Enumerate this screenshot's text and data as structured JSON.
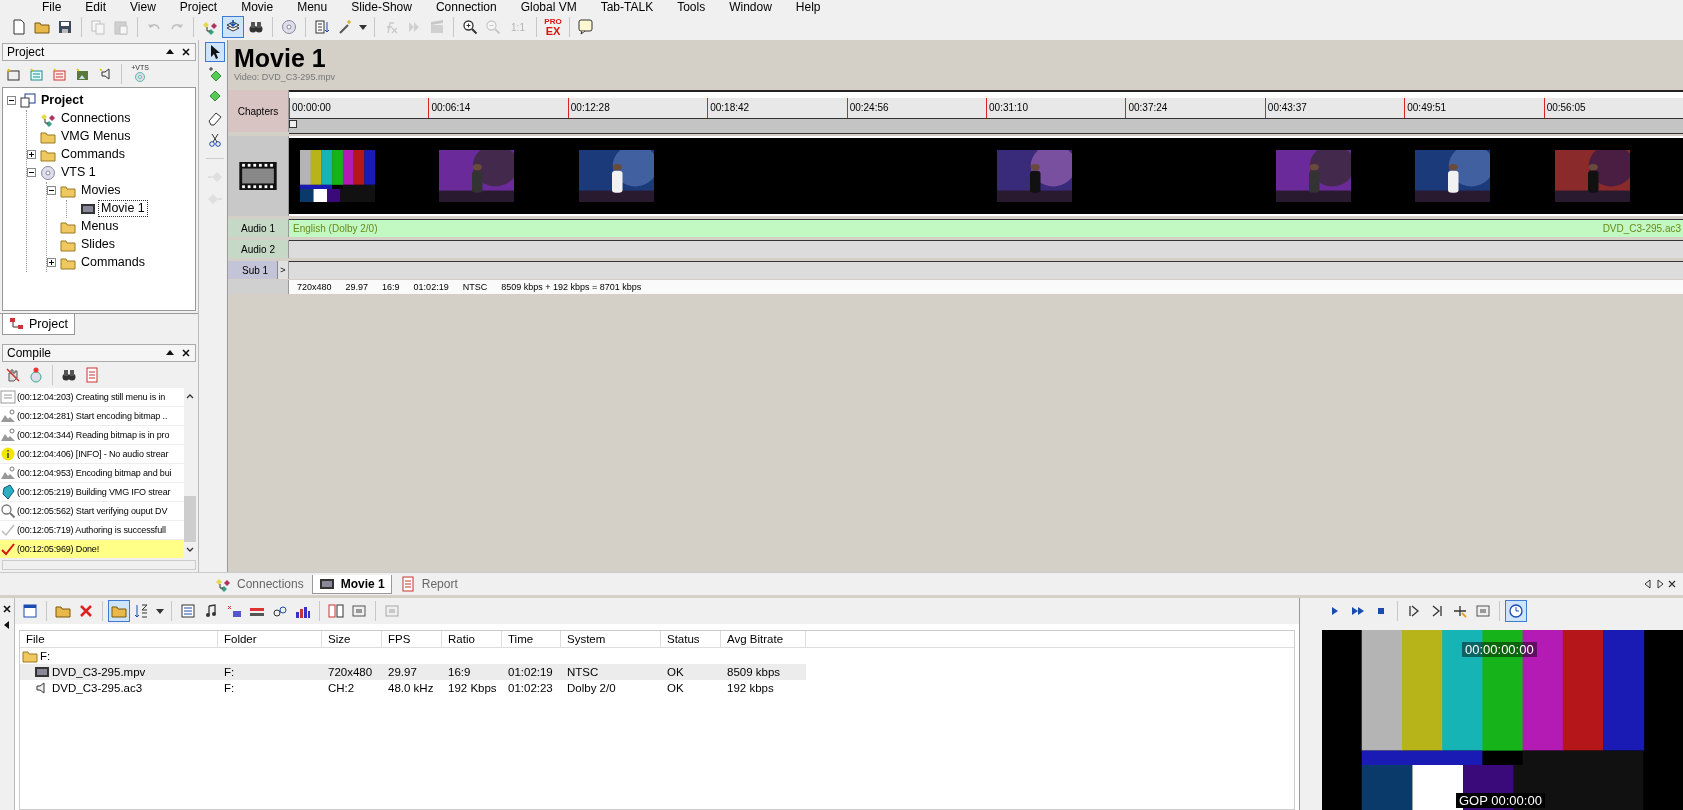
{
  "menu": [
    "File",
    "Edit",
    "View",
    "Project",
    "Movie",
    "Menu",
    "Slide-Show",
    "Connection",
    "Global VM",
    "Tab-TALK",
    "Tools",
    "Window",
    "Help"
  ],
  "toolbar": [
    [
      {
        "kind": "new",
        "pressed": false,
        "disabled": false
      },
      {
        "kind": "open",
        "pressed": false,
        "disabled": false
      },
      {
        "kind": "save",
        "pressed": false,
        "disabled": false
      }
    ],
    [
      {
        "kind": "copy",
        "pressed": false,
        "disabled": true
      },
      {
        "kind": "paste",
        "pressed": false,
        "disabled": true
      }
    ],
    [
      {
        "kind": "undo",
        "pressed": false,
        "disabled": true
      },
      {
        "kind": "redo",
        "pressed": false,
        "disabled": true
      }
    ],
    [
      {
        "kind": "connect",
        "pressed": false,
        "disabled": false
      },
      {
        "kind": "stack",
        "pressed": true,
        "disabled": false
      },
      {
        "kind": "binoculars",
        "pressed": false,
        "disabled": false
      }
    ],
    [
      {
        "kind": "disc",
        "pressed": false,
        "disabled": false
      }
    ],
    [
      {
        "kind": "list",
        "pressed": false,
        "disabled": false
      },
      {
        "kind": "wand",
        "pressed": false,
        "disabled": false
      },
      {
        "kind": "caret",
        "pressed": false,
        "disabled": false
      }
    ],
    [
      {
        "kind": "fx",
        "pressed": false,
        "disabled": true
      },
      {
        "kind": "dfx",
        "pressed": false,
        "disabled": true
      },
      {
        "kind": "clip",
        "pressed": false,
        "disabled": true
      }
    ],
    [
      {
        "kind": "zoomin",
        "pressed": false,
        "disabled": false
      },
      {
        "kind": "zoomout",
        "pressed": false,
        "disabled": true
      },
      {
        "kind": "text",
        "text": "1:1",
        "pressed": false,
        "disabled": true
      }
    ],
    [
      {
        "kind": "proex",
        "text": "PRO",
        "text2": "EX",
        "pressed": false,
        "disabled": false
      }
    ],
    [
      {
        "kind": "help",
        "pressed": false,
        "disabled": false
      }
    ]
  ],
  "project_panel": {
    "title": "Project",
    "toolbar": [
      [
        {
          "kind": "newmovie",
          "pressed": false,
          "disabled": false
        },
        {
          "kind": "newmenu",
          "pressed": false,
          "disabled": false
        },
        {
          "kind": "newmenu2",
          "pressed": false,
          "disabled": false
        },
        {
          "kind": "newslide",
          "pressed": false,
          "disabled": false
        },
        {
          "kind": "newaudio",
          "pressed": false,
          "disabled": false
        }
      ],
      [
        {
          "kind": "newvts",
          "text": "+VTS",
          "pressed": false,
          "disabled": false
        }
      ]
    ],
    "tree": [
      {
        "label": "Project",
        "kind": "project",
        "expanded": true,
        "selected": false,
        "children": [
          {
            "label": "Connections",
            "kind": "connect",
            "selected": false
          },
          {
            "label": "VMG Menus",
            "kind": "folder",
            "selected": false
          },
          {
            "label": "Commands",
            "kind": "folder",
            "expanded": false,
            "selected": false
          },
          {
            "label": "VTS 1",
            "kind": "disc",
            "expanded": true,
            "selected": false,
            "children": [
              {
                "label": "Movies",
                "kind": "folder",
                "expanded": true,
                "selected": false,
                "children": [
                  {
                    "label": "Movie 1",
                    "kind": "film",
                    "selected": true
                  }
                ]
              },
              {
                "label": "Menus",
                "kind": "folder",
                "selected": false
              },
              {
                "label": "Slides",
                "kind": "folder",
                "selected": false
              },
              {
                "label": "Commands",
                "kind": "folder",
                "expanded": false,
                "selected": false
              }
            ]
          }
        ]
      }
    ],
    "tab": "Project"
  },
  "compile_panel": {
    "title": "Compile",
    "toolbar": [
      [
        {
          "kind": "stop",
          "pressed": false,
          "disabled": false
        },
        {
          "kind": "burn",
          "pressed": false,
          "disabled": false
        }
      ],
      [
        {
          "kind": "binoculars",
          "pressed": false,
          "disabled": false
        },
        {
          "kind": "report",
          "pressed": false,
          "disabled": false
        }
      ]
    ],
    "log": [
      {
        "kind": "menu",
        "text": "(00:12:04:203) Creating still menu is in"
      },
      {
        "kind": "bitmap",
        "text": "(00:12:04:281) Start encoding bitmap .."
      },
      {
        "kind": "bitmap",
        "text": "(00:12:04:344) Reading bitmap is in pro"
      },
      {
        "kind": "info",
        "text": "(00:12:04:406) [INFO] - No audio strear"
      },
      {
        "kind": "bitmap",
        "text": "(00:12:04:953) Encoding bitmap and bui"
      },
      {
        "kind": "build",
        "text": "(00:12:05:219) Building VMG IFO strear"
      },
      {
        "kind": "verify",
        "text": "(00:12:05:562) Start verifying ouput DV"
      },
      {
        "kind": "success",
        "text": "(00:12:05:719) Authoring is successfull"
      },
      {
        "kind": "done",
        "text": "(00:12:05:969) Done!"
      }
    ]
  },
  "tools": [
    [
      {
        "kind": "pointer",
        "pressed": true,
        "disabled": false
      },
      {
        "kind": "addchapter",
        "pressed": false,
        "disabled": false
      },
      {
        "kind": "chapter",
        "pressed": false,
        "disabled": false
      },
      {
        "kind": "eraser",
        "pressed": false,
        "disabled": false
      },
      {
        "kind": "scissors",
        "pressed": false,
        "disabled": false
      }
    ],
    [
      {
        "kind": "prevchapter",
        "pressed": false,
        "disabled": true
      },
      {
        "kind": "nextchapter",
        "pressed": false,
        "disabled": true
      }
    ]
  ],
  "movie": {
    "title": "Movie 1",
    "subtitle": "Video: DVD_C3-295.mpv",
    "chapters_label": "Chapters",
    "ticks": [
      "00:00:00",
      "00:06:14",
      "00:12:28",
      "00:18:42",
      "00:24:56",
      "00:31:10",
      "00:37:24",
      "00:43:37",
      "00:49:51",
      "00:56:05"
    ],
    "thumbnails": [
      {
        "kind": "picture"
      },
      {
        "kind": "picture"
      },
      {
        "kind": "picture"
      },
      {
        "kind": "blank"
      },
      {
        "kind": "blank"
      },
      {
        "kind": "picture"
      },
      {
        "kind": "blank"
      },
      {
        "kind": "picture"
      },
      {
        "kind": "picture"
      },
      {
        "kind": "picture"
      }
    ],
    "tracks": [
      {
        "kind": "audio",
        "label": "Audio 1",
        "text": "English (Dolby 2/0)",
        "file": "DVD_C3-295.ac3"
      },
      {
        "kind": "audio",
        "label": "Audio 2"
      },
      {
        "kind": "sub",
        "label": "Sub 1",
        "button": ">"
      }
    ],
    "info": [
      "720x480",
      "29.97",
      "16:9",
      "01:02:19",
      "NTSC",
      "8509 kbps + 192 kbps = 8701 kbps"
    ]
  },
  "bottom_tabs": [
    {
      "label": "Connections",
      "kind": "connect",
      "selected": false
    },
    {
      "label": "Movie 1",
      "kind": "film",
      "selected": true
    },
    {
      "label": "Report",
      "kind": "report",
      "selected": false
    }
  ],
  "files": {
    "toolbar": [
      [
        {
          "kind": "window",
          "pressed": false,
          "disabled": false
        }
      ],
      [
        {
          "kind": "open",
          "pressed": false,
          "disabled": false
        },
        {
          "kind": "delete",
          "pressed": false,
          "disabled": false
        }
      ],
      [
        {
          "kind": "folderview",
          "pressed": true,
          "disabled": false
        },
        {
          "kind": "sort",
          "pressed": false,
          "disabled": false
        },
        {
          "kind": "caret",
          "pressed": false,
          "disabled": false
        }
      ],
      [
        {
          "kind": "props",
          "pressed": false,
          "disabled": false
        },
        {
          "kind": "audio",
          "pressed": false,
          "disabled": false
        },
        {
          "kind": "ac3",
          "pressed": false,
          "disabled": false
        },
        {
          "kind": "bar",
          "pressed": false,
          "disabled": false
        },
        {
          "kind": "link",
          "pressed": false,
          "disabled": false
        },
        {
          "kind": "chart",
          "pressed": false,
          "disabled": false
        }
      ],
      [
        {
          "kind": "split",
          "pressed": false,
          "disabled": false
        },
        {
          "kind": "tool",
          "pressed": false,
          "disabled": false
        }
      ],
      [
        {
          "kind": "tool",
          "pressed": false,
          "disabled": true
        }
      ]
    ],
    "columns": [
      "File",
      "Folder",
      "Size",
      "FPS",
      "Ratio",
      "Time",
      "System",
      "Status",
      "Avg Bitrate"
    ],
    "group": "F:",
    "rows": [
      {
        "kind": "video",
        "selected": true,
        "cells": [
          "DVD_C3-295.mpv",
          "F:",
          "720x480",
          "29.97",
          "16:9",
          "01:02:19",
          "NTSC",
          "OK",
          "8509 kbps"
        ]
      },
      {
        "kind": "audio",
        "selected": false,
        "cells": [
          "DVD_C3-295.ac3",
          "F:",
          "CH:2",
          "48.0 kHz",
          "192 Kbps",
          "01:02:23",
          "Dolby 2/0",
          "OK",
          "192 kbps"
        ]
      }
    ]
  },
  "preview": {
    "toolbar": [
      [
        {
          "kind": "play",
          "pressed": false,
          "disabled": false
        },
        {
          "kind": "ff",
          "pressed": false,
          "disabled": false
        },
        {
          "kind": "stopsq",
          "pressed": false,
          "disabled": false
        }
      ],
      [
        {
          "kind": "markin",
          "pressed": false,
          "disabled": false
        },
        {
          "kind": "markout",
          "pressed": false,
          "disabled": false
        },
        {
          "kind": "addmark",
          "pressed": false,
          "disabled": false
        },
        {
          "kind": "tool",
          "pressed": false,
          "disabled": false
        }
      ],
      [
        {
          "kind": "clock",
          "pressed": true,
          "disabled": false
        }
      ]
    ],
    "timecode": "00:00:00:00",
    "gop": "GOP 00:00:00"
  }
}
